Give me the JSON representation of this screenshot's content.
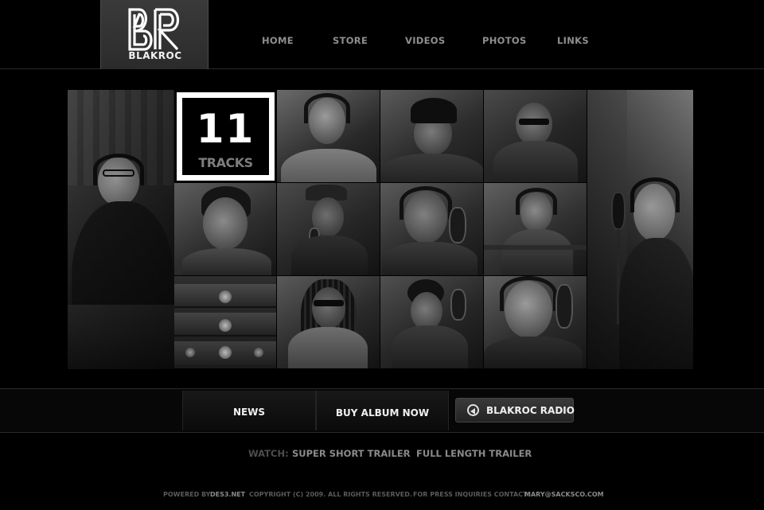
{
  "header": {
    "logo_text": "BLAKROC",
    "nav": [
      "HOME",
      "STORE",
      "VIDEOS",
      "PHOTOS",
      "LINKS"
    ]
  },
  "feature": {
    "tracks_number": "11",
    "tracks_label": "TRACKS"
  },
  "buttons": {
    "news": "NEWS",
    "buy": "BUY ALBUM NOW",
    "radio": "BLAKROC RADIO"
  },
  "watch": {
    "label": "WATCH:",
    "trailer_short": "SUPER SHORT TRAILER",
    "separator": "-",
    "trailer_full": "FULL LENGTH TRAILER"
  },
  "footer": {
    "powered_label": "POWERED BY:",
    "powered_by": "DES3.NET",
    "copyright": "COPYRIGHT (C) 2009. ALL RIGHTS RESERVED.",
    "press_label": "FOR PRESS INQUIRIES CONTACT:",
    "press_email": "MARY@SACKSCO.COM"
  },
  "colors": {
    "background": "#000000",
    "nav_text": "#8e8e8e",
    "tile_border": "#ffffff"
  }
}
